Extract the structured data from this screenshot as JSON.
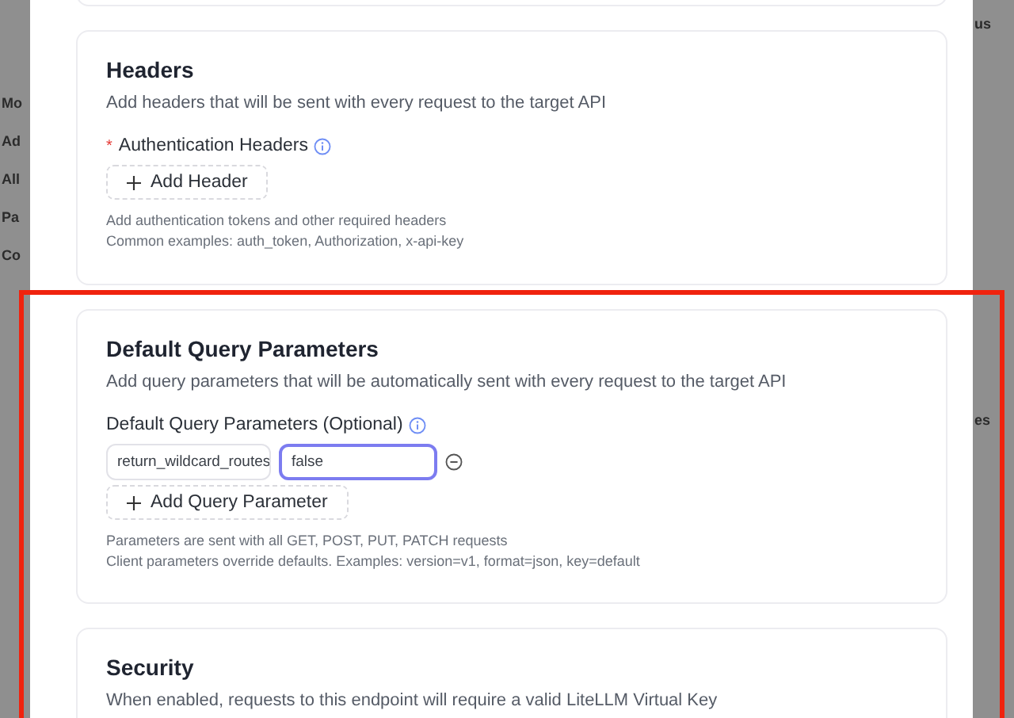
{
  "background": {
    "left_fragments": [
      "Mo",
      "Ad",
      "All",
      "Pa",
      "Co"
    ],
    "right_fragments": [
      "us",
      "es"
    ]
  },
  "sections": [
    {
      "kind": "headers",
      "title": "Headers",
      "description": "Add headers that will be sent with every request to the target API",
      "field_label": "Authentication Headers",
      "required_mark": "*",
      "add_button": "Add Header",
      "hints": [
        "Add authentication tokens and other required headers",
        "Common examples: auth_token, Authorization, x-api-key"
      ]
    },
    {
      "kind": "query",
      "title": "Default Query Parameters",
      "description": "Add query parameters that will be automatically sent with every request to the target API",
      "field_label": "Default Query Parameters (Optional)",
      "highlighted": true,
      "params": [
        {
          "key": "return_wildcard_routes",
          "value": "false",
          "focused": true
        }
      ],
      "add_button": "Add Query Parameter",
      "hints": [
        "Parameters are sent with all GET, POST, PUT, PATCH requests",
        "Client parameters override defaults. Examples: version=v1, format=json, key=default"
      ]
    },
    {
      "kind": "security",
      "title": "Security",
      "description": "When enabled, requests to this endpoint will require a valid LiteLLM Virtual Key"
    }
  ]
}
